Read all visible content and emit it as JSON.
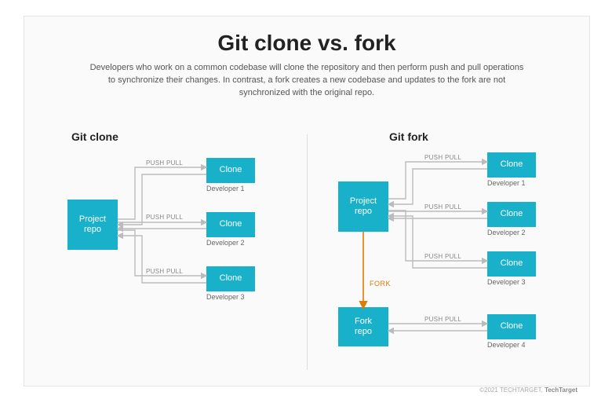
{
  "title": "Git clone vs. fork",
  "subtitle": "Developers who work on a common codebase will clone the repository and then perform push and pull operations to synchronize their changes. In contrast, a fork creates a new codebase and updates to the fork are not synchronized with the original repo.",
  "sections": {
    "left_label": "Git clone",
    "right_label": "Git fork"
  },
  "left": {
    "project": "Project\nrepo",
    "clones": [
      {
        "box": "Clone",
        "dev": "Developer 1",
        "edge": "PUSH PULL"
      },
      {
        "box": "Clone",
        "dev": "Developer 2",
        "edge": "PUSH PULL"
      },
      {
        "box": "Clone",
        "dev": "Developer 3",
        "edge": "PUSH PULL"
      }
    ]
  },
  "right": {
    "project": "Project\nrepo",
    "clones": [
      {
        "box": "Clone",
        "dev": "Developer 1",
        "edge": "PUSH PULL"
      },
      {
        "box": "Clone",
        "dev": "Developer 2",
        "edge": "PUSH PULL"
      },
      {
        "box": "Clone",
        "dev": "Developer 3",
        "edge": "PUSH PULL"
      }
    ],
    "fork_box": "Fork\nrepo",
    "fork_edge": "FORK",
    "fork_clone": {
      "box": "Clone",
      "dev": "Developer 4",
      "edge": "PUSH PULL"
    }
  },
  "copyright_prefix": "©2021 TECHTARGET, ",
  "copyright_brand": "TechTarget"
}
